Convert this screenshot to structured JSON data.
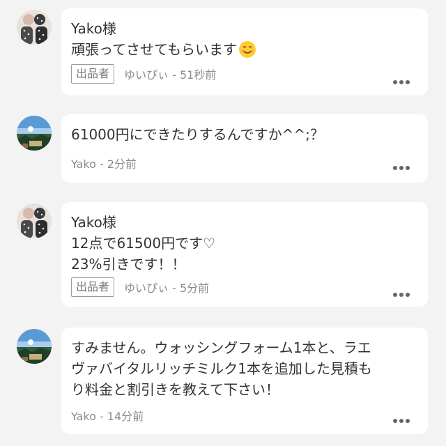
{
  "comments": [
    {
      "author_greeting": "Yako様",
      "body": "頑張ってさせてもらいます",
      "emoji": "smiling-face",
      "badge": "出品者",
      "meta": "ゆいぴぃ - 51秒前"
    },
    {
      "body": "61000円にできたりするんですか^^;？",
      "meta": "Yako - 2分前"
    },
    {
      "author_greeting": "Yako様",
      "body": "12点で61500円です♡\n23%引きです！！",
      "badge": "出品者",
      "meta": "ゆいぴぃ - 5分前"
    },
    {
      "body": "すみません。ウォッシングフォーム1本と、ラエ\nヴァバイタルリッチミルク1本を追加した見積も\nり料金と割引きを教えて下さい！",
      "meta": "Yako - 14分前"
    }
  ]
}
